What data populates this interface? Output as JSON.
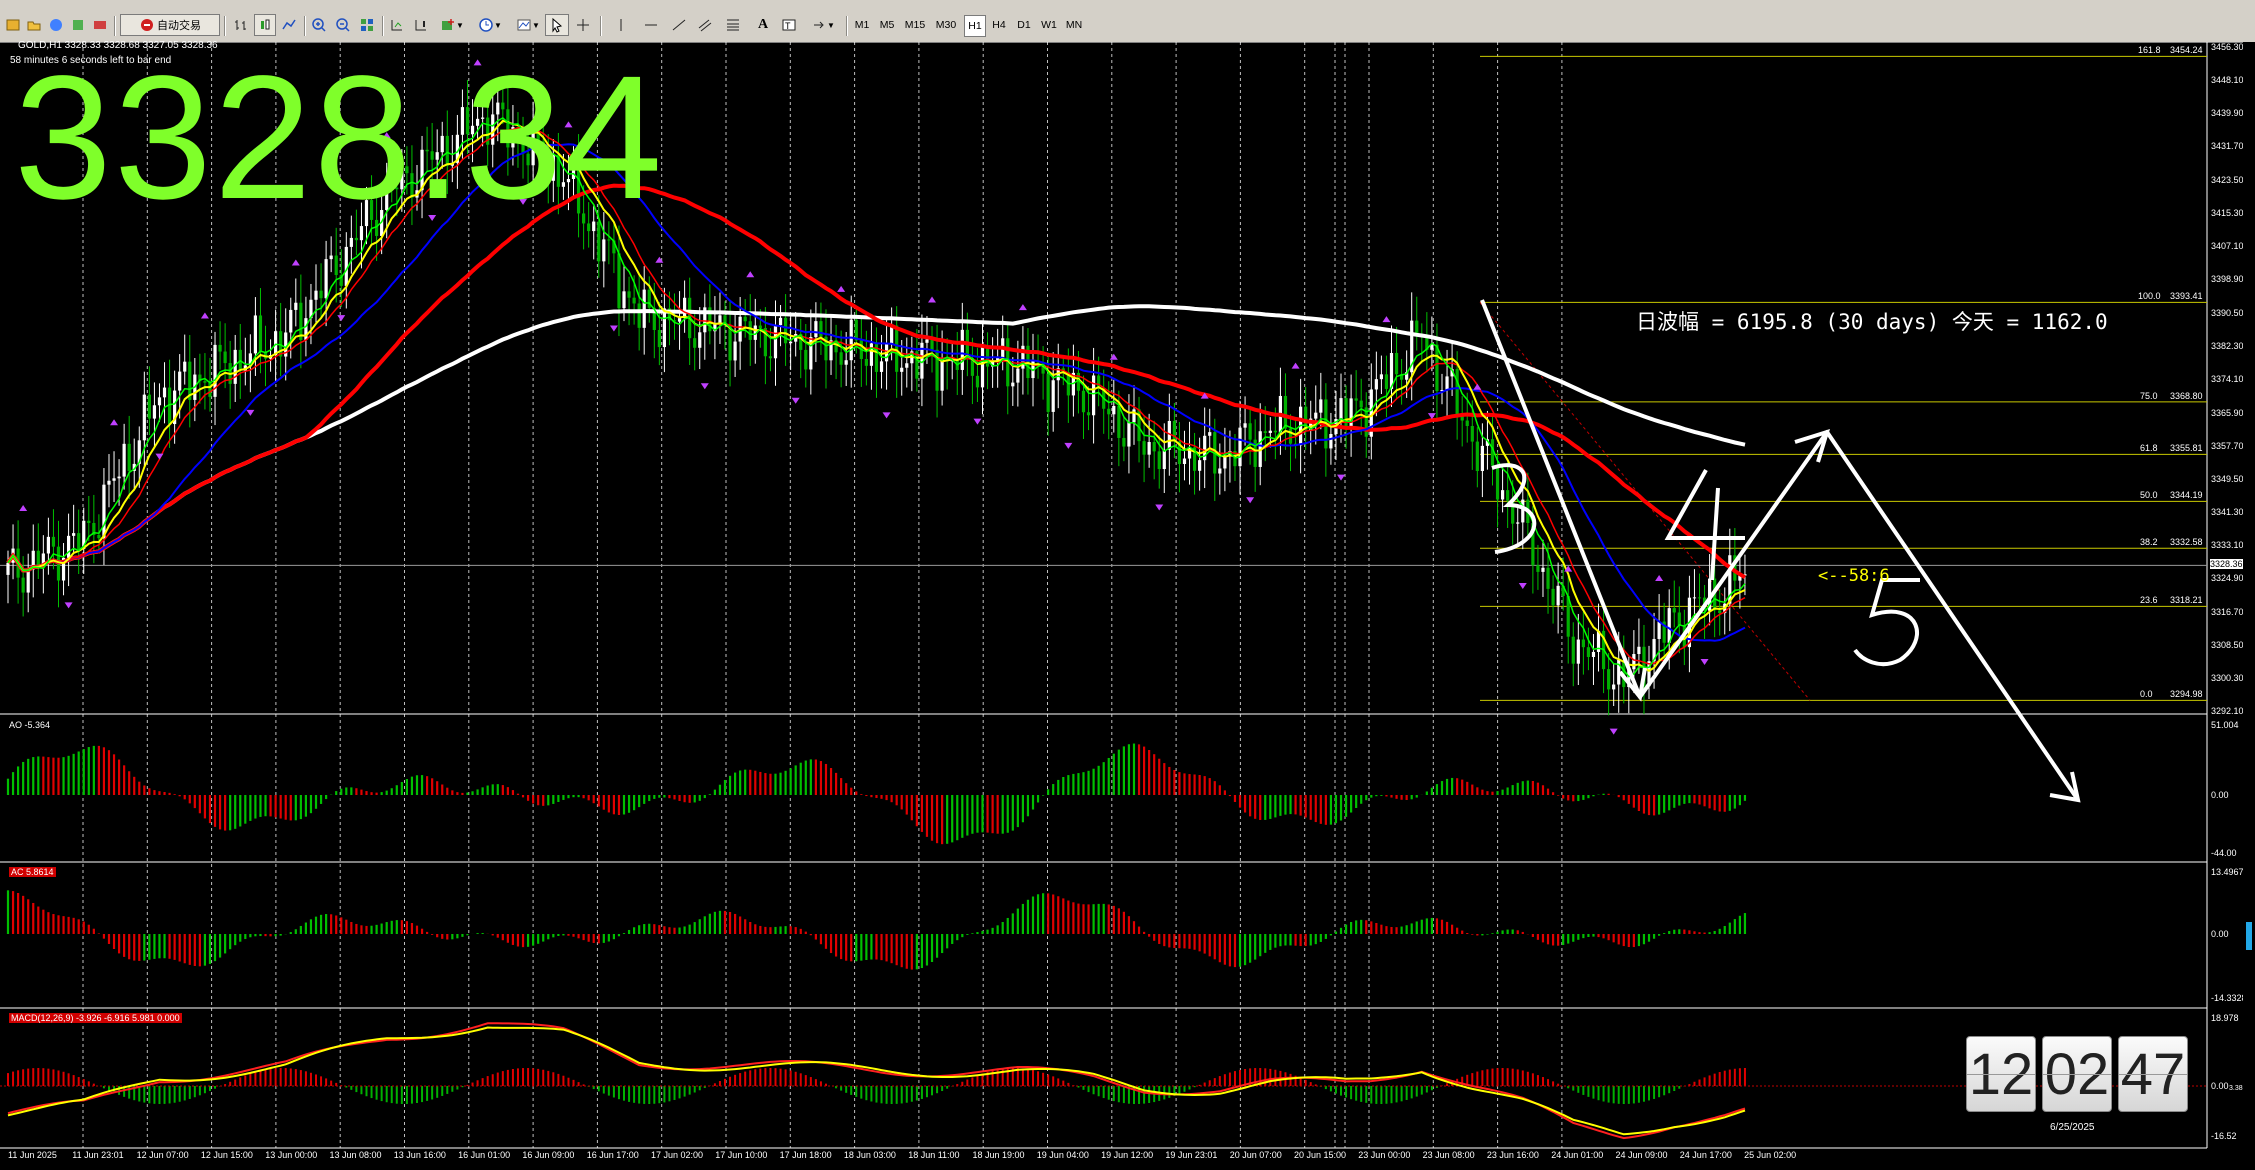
{
  "window": {
    "title": ""
  },
  "toolbar": {
    "autotrade_label": "自动交易",
    "timeframes": [
      "M1",
      "M5",
      "M15",
      "M30",
      "H1",
      "H4",
      "D1",
      "W1",
      "MN"
    ],
    "active_timeframe": "H1"
  },
  "chart": {
    "symbol_line": "GOLD,H1  3328.33 3328.68 3327.05 3328.36",
    "countdown": "58 minutes 6 seconds left to bar end",
    "big_price": "3328.34",
    "current_price_label": "3328.36",
    "volatility_text": "日波幅 = 6195.8  (30 days)     今天 = 1162.0",
    "count_label": "<--58:6",
    "wave_numbers": [
      "3",
      "4",
      "5"
    ],
    "price_axis": [
      "3456.30",
      "3448.10",
      "3439.90",
      "3431.70",
      "3423.50",
      "3415.30",
      "3407.10",
      "3398.90",
      "3390.50",
      "3382.30",
      "3374.10",
      "3365.90",
      "3357.70",
      "3349.50",
      "3341.30",
      "3333.10",
      "3324.90",
      "3316.70",
      "3308.50",
      "3300.30",
      "3292.10"
    ],
    "time_axis": [
      "11 Jun 2025",
      "11 Jun 23:01",
      "12 Jun 07:00",
      "12 Jun 15:00",
      "13 Jun 00:00",
      "13 Jun 08:00",
      "13 Jun 16:00",
      "16 Jun 01:00",
      "16 Jun 09:00",
      "16 Jun 17:00",
      "17 Jun 02:00",
      "17 Jun 10:00",
      "17 Jun 18:00",
      "18 Jun 03:00",
      "18 Jun 11:00",
      "18 Jun 19:00",
      "19 Jun 04:00",
      "19 Jun 12:00",
      "19 Jun 23:01",
      "20 Jun 07:00",
      "20 Jun 15:00",
      "23 Jun 00:00",
      "23 Jun 08:00",
      "23 Jun 16:00",
      "24 Jun 01:00",
      "24 Jun 09:00",
      "24 Jun 17:00",
      "25 Jun 02:00"
    ],
    "fib_levels": [
      {
        "label": "161.8",
        "price": "3454.24",
        "value": 3454.24
      },
      {
        "label": "100.0",
        "price": "3393.41",
        "value": 3393.41
      },
      {
        "label": "75.0",
        "price": "3368.80",
        "value": 3368.8
      },
      {
        "label": "61.8",
        "price": "3355.81",
        "value": 3355.81
      },
      {
        "label": "50.0",
        "price": "3344.19",
        "value": 3344.19
      },
      {
        "label": "38.2",
        "price": "3332.58",
        "value": 3332.58
      },
      {
        "label": "23.6",
        "price": "3318.21",
        "value": 3318.21
      },
      {
        "label": "0.0",
        "price": "3294.98",
        "value": 3294.98
      }
    ]
  },
  "indicators": {
    "ao": {
      "label": "AO -5.364",
      "top": "51.004",
      "zero": "0.00",
      "bottom": "-44.00"
    },
    "ac": {
      "label": "AC 5.8614",
      "top": "13.4967",
      "zero": "0.00",
      "bottom": "-14.3328"
    },
    "macd": {
      "label": "MACD(12,26,9) -3.926 -6.916 5.981 0.000",
      "top": "18.978",
      "zero": "0.00",
      "bottom": "-16.52",
      "extra": "3.38"
    }
  },
  "clock": {
    "hours": "12",
    "minutes": "02",
    "seconds": "47",
    "date": "6/25/2025"
  },
  "colors": {
    "ma_fast": "#00ff00",
    "ma_yellow": "#ffff00",
    "ma_red": "#ff0000",
    "ma_blue": "#0000ff",
    "ma_white": "#ffffff",
    "big_price": "#7fff2a"
  }
}
